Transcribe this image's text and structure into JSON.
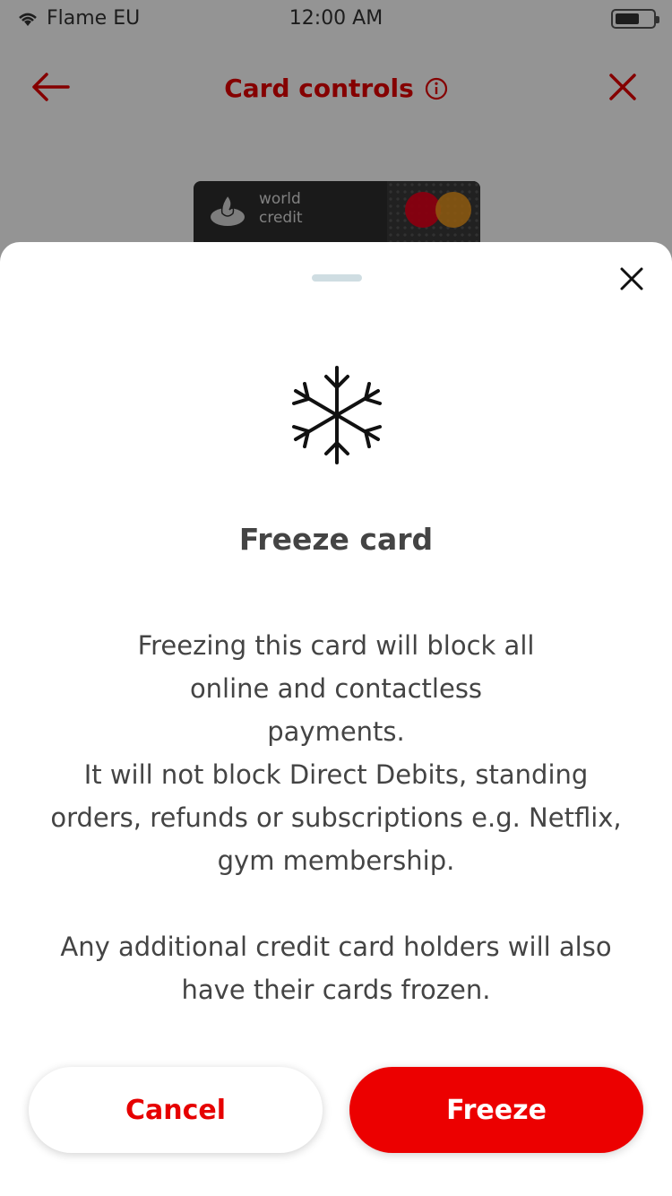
{
  "status_bar": {
    "carrier": "Flame EU",
    "time": "12:00 AM",
    "battery_level": 0.55
  },
  "nav": {
    "title": "Card controls",
    "icons": [
      "arrow-left-icon",
      "info-icon",
      "close-icon"
    ]
  },
  "card": {
    "line1": "world",
    "line2": "credit"
  },
  "sheet": {
    "title": "Freeze card",
    "paragraph_1": "Freezing this card will block all online and contactless payments.",
    "paragraph_2": "It will not block Direct Debits, standing orders, refunds or subscriptions e.g. Netflix, gym membership.",
    "paragraph_3": "Any additional credit card holders will also have their cards frozen.",
    "cancel_label": "Cancel",
    "freeze_label": "Freeze",
    "icon": "snowflake-icon"
  },
  "colors": {
    "accent": "#ec0000",
    "overlay": "rgba(0,0,0,0.42)",
    "text": "#444444"
  }
}
